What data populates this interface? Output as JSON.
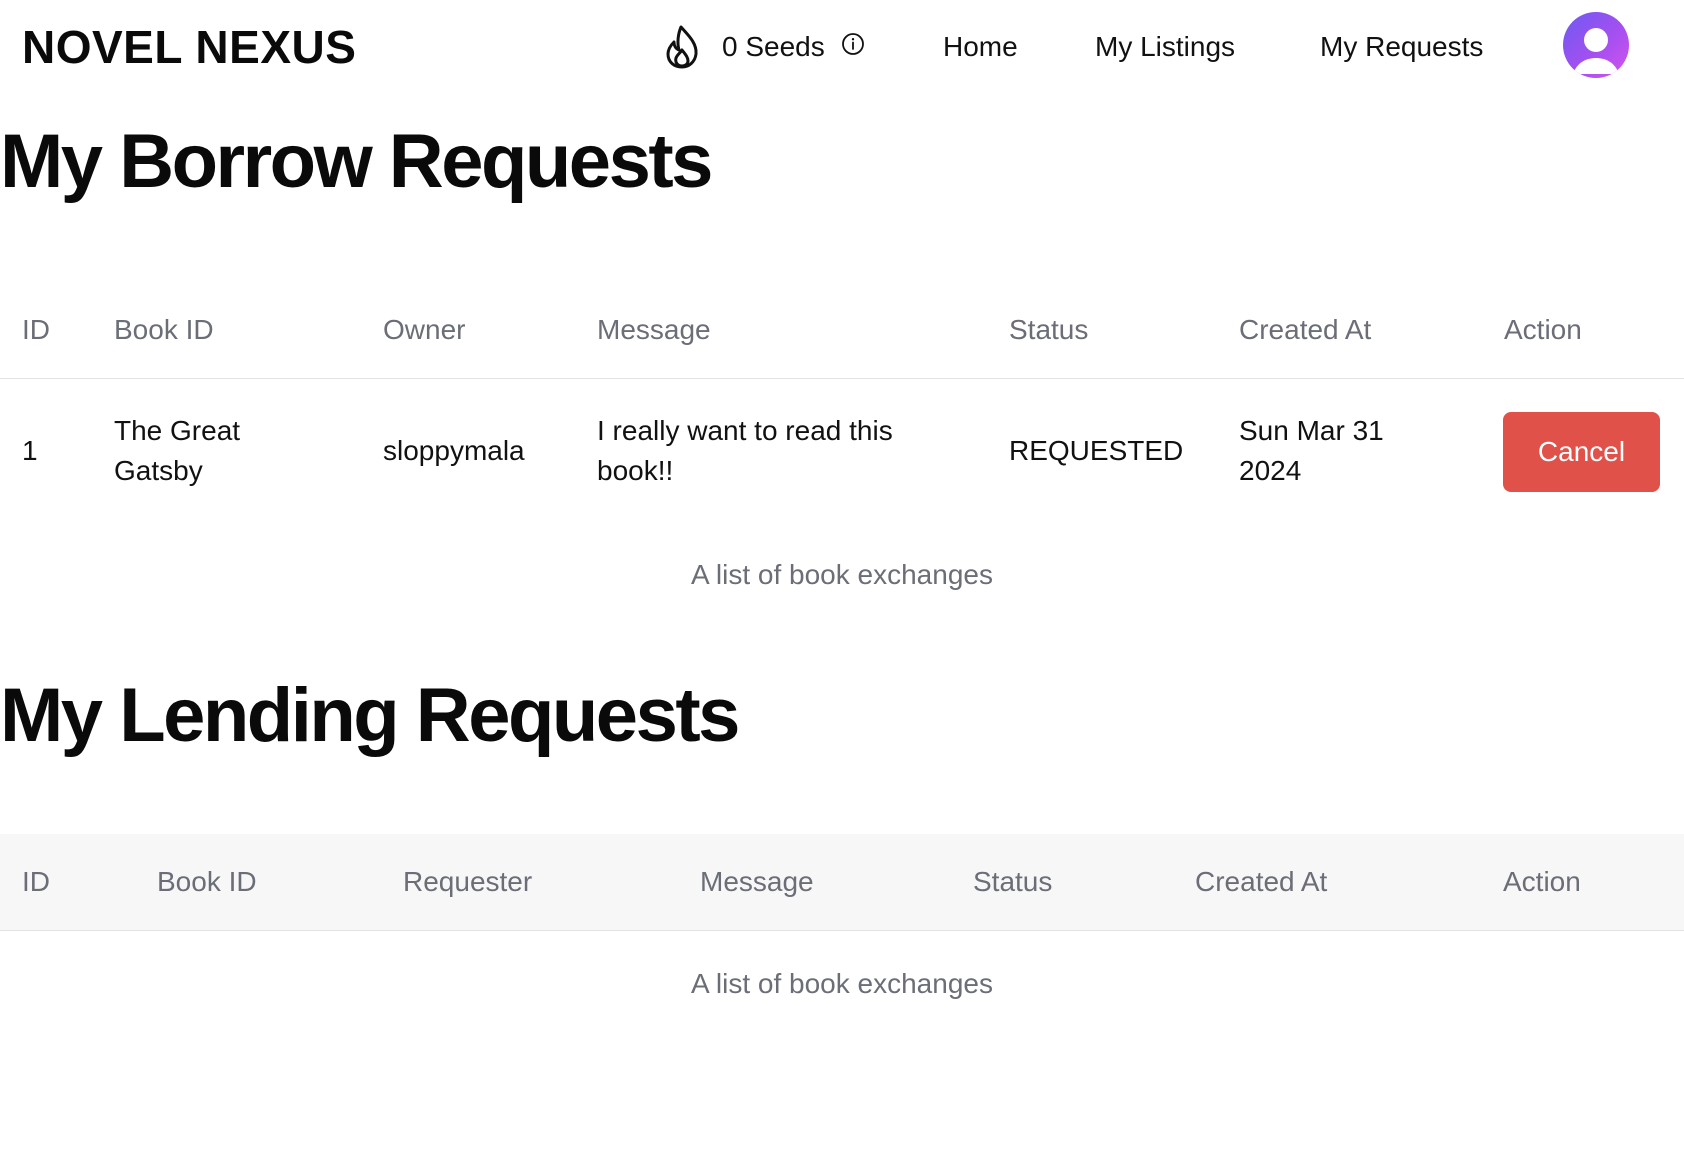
{
  "navbar": {
    "brand": "NOVEL NEXUS",
    "seeds_text": "0 Seeds",
    "links": {
      "home": "Home",
      "my_listings": "My Listings",
      "my_requests": "My Requests"
    }
  },
  "borrow": {
    "title": "My Borrow Requests",
    "columns": {
      "id": "ID",
      "book_id": "Book ID",
      "owner": "Owner",
      "message": "Message",
      "status": "Status",
      "created_at": "Created At",
      "action": "Action"
    },
    "rows": [
      {
        "id": "1",
        "book_line1": "The Great",
        "book_line2": "Gatsby",
        "owner": "sloppymala",
        "message_line1": "I really want to read this",
        "message_line2": "book!!",
        "status": "REQUESTED",
        "created_line1": "Sun Mar 31",
        "created_line2": "2024",
        "action_label": "Cancel"
      }
    ],
    "caption": "A list of book exchanges"
  },
  "lending": {
    "title": "My Lending Requests",
    "columns": {
      "id": "ID",
      "book_id": "Book ID",
      "requester": "Requester",
      "message": "Message",
      "status": "Status",
      "created_at": "Created At",
      "action": "Action"
    },
    "caption": "A list of book exchanges"
  },
  "icons": {
    "seeds": "flame-icon",
    "seeds_info": "info-icon",
    "profile": "user-avatar-icon"
  },
  "colors": {
    "cancel_button": "#e0514a",
    "avatar_gradient_start": "#6d5bf2",
    "avatar_gradient_end": "#d455ee",
    "muted_text": "#6b6e76"
  }
}
